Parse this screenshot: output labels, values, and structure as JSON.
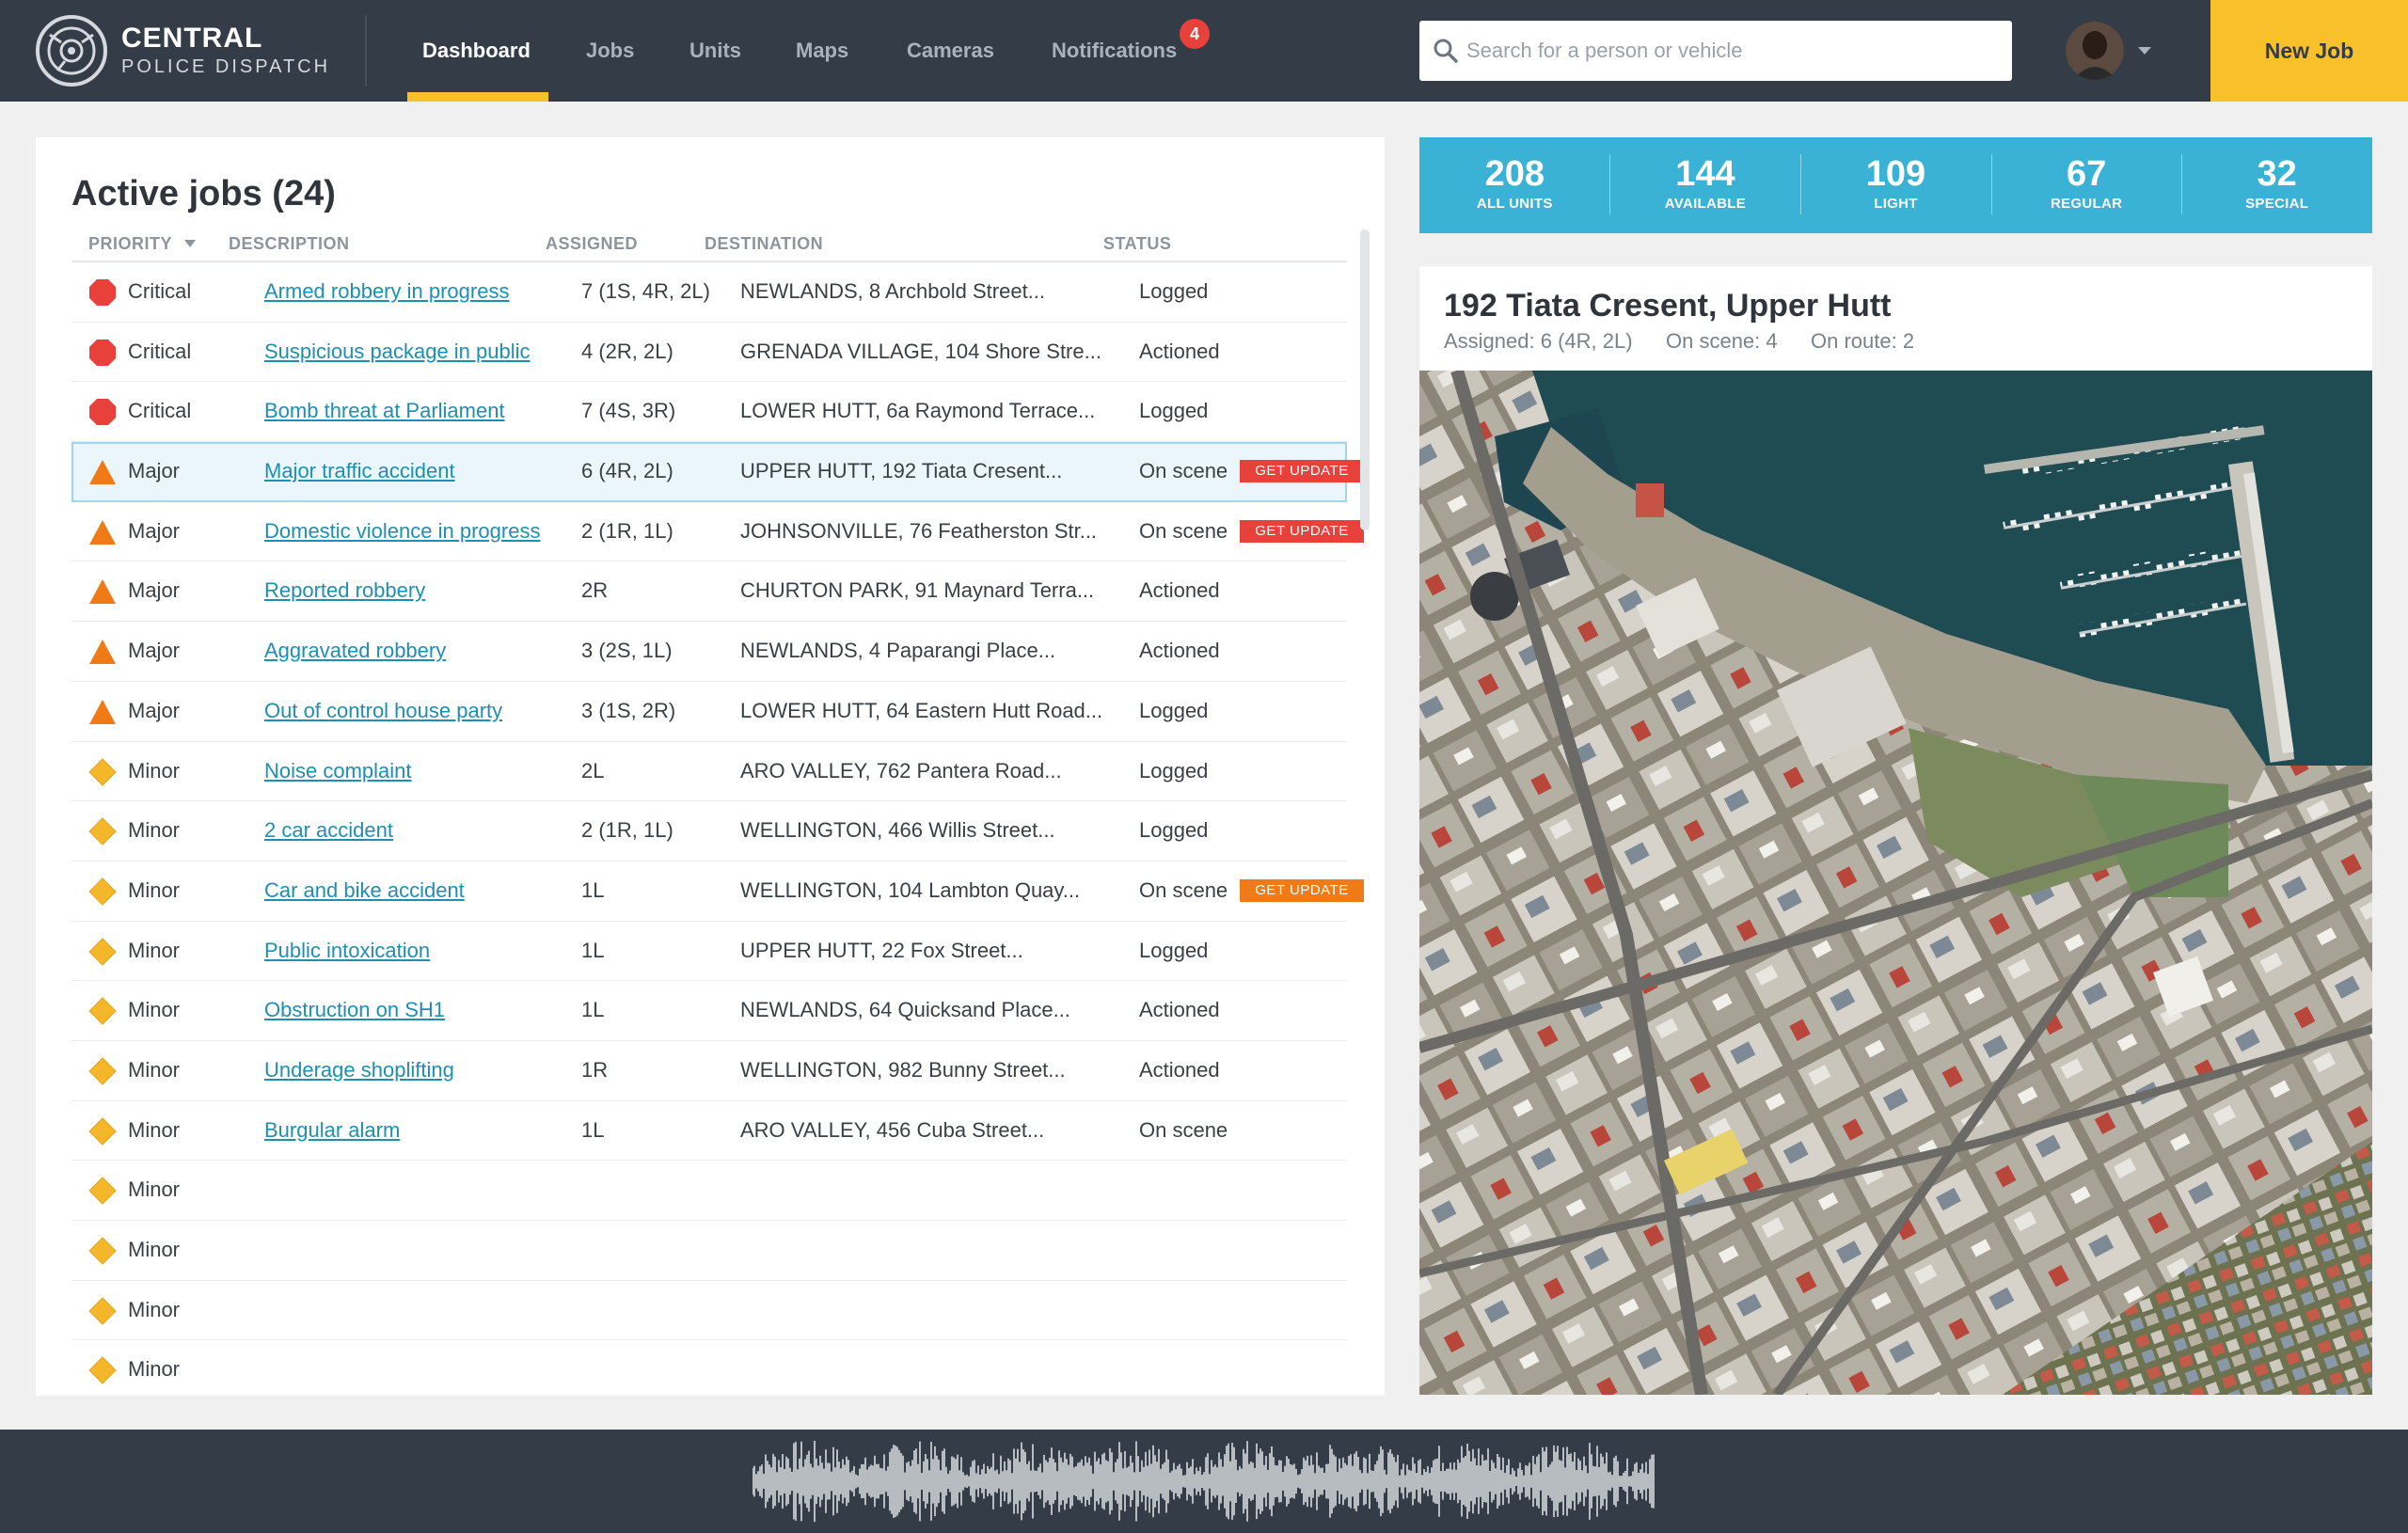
{
  "brand": {
    "line1": "CENTRAL",
    "line2": "POLICE DISPATCH"
  },
  "nav": {
    "items": [
      {
        "label": "Dashboard",
        "active": true
      },
      {
        "label": "Jobs"
      },
      {
        "label": "Units"
      },
      {
        "label": "Maps"
      },
      {
        "label": "Cameras"
      },
      {
        "label": "Notifications"
      }
    ],
    "notifications_count": "4"
  },
  "search": {
    "placeholder": "Search for a person or vehicle",
    "value": ""
  },
  "new_job_label": "New Job",
  "active_jobs": {
    "title": "Active jobs (24)",
    "columns": [
      "PRIORITY",
      "DESCRIPTION",
      "ASSIGNED",
      "DESTINATION",
      "STATUS"
    ],
    "sort_column": "PRIORITY",
    "get_update_label": "GET UPDATE",
    "rows": [
      {
        "priority": "Critical",
        "description": "Armed robbery in progress",
        "assigned": "7 (1S, 4R, 2L)",
        "destination": "NEWLANDS, 8 Archbold Street...",
        "status": "Logged"
      },
      {
        "priority": "Critical",
        "description": "Suspicious package in public",
        "assigned": "4 (2R, 2L)",
        "destination": "GRENADA VILLAGE, 104 Shore Stre...",
        "status": "Actioned"
      },
      {
        "priority": "Critical",
        "description": "Bomb threat at Parliament",
        "assigned": "7 (4S, 3R)",
        "destination": "LOWER HUTT, 6a Raymond Terrace...",
        "status": "Logged"
      },
      {
        "priority": "Major",
        "description": "Major traffic accident",
        "assigned": "6 (4R, 2L)",
        "destination": "UPPER HUTT, 192 Tiata Cresent...",
        "status": "On scene",
        "get_update": true,
        "get_update_color": "#e8413b",
        "selected": true
      },
      {
        "priority": "Major",
        "description": "Domestic violence in progress",
        "assigned": "2 (1R, 1L)",
        "destination": "JOHNSONVILLE, 76 Featherston Str...",
        "status": "On scene",
        "get_update": true,
        "get_update_color": "#e8413b"
      },
      {
        "priority": "Major",
        "description": "Reported robbery",
        "assigned": "2R",
        "destination": "CHURTON PARK, 91 Maynard Terra...",
        "status": "Actioned"
      },
      {
        "priority": "Major",
        "description": "Aggravated robbery",
        "assigned": "3 (2S, 1L)",
        "destination": "NEWLANDS, 4 Paparangi Place...",
        "status": "Actioned"
      },
      {
        "priority": "Major",
        "description": "Out of control house party",
        "assigned": "3 (1S, 2R)",
        "destination": "LOWER HUTT, 64 Eastern Hutt Road...",
        "status": "Logged"
      },
      {
        "priority": "Minor",
        "description": "Noise complaint",
        "assigned": "2L",
        "destination": "ARO VALLEY, 762 Pantera Road...",
        "status": "Logged"
      },
      {
        "priority": "Minor",
        "description": "2 car accident",
        "assigned": "2 (1R, 1L)",
        "destination": "WELLINGTON, 466 Willis Street...",
        "status": "Logged"
      },
      {
        "priority": "Minor",
        "description": "Car and bike accident",
        "assigned": "1L",
        "destination": "WELLINGTON, 104 Lambton Quay...",
        "status": "On scene",
        "get_update": true,
        "get_update_color": "#f07b16"
      },
      {
        "priority": "Minor",
        "description": "Public intoxication",
        "assigned": "1L",
        "destination": "UPPER HUTT, 22 Fox Street...",
        "status": "Logged"
      },
      {
        "priority": "Minor",
        "description": "Obstruction on SH1",
        "assigned": "1L",
        "destination": "NEWLANDS, 64 Quicksand Place...",
        "status": "Actioned"
      },
      {
        "priority": "Minor",
        "description": "Underage shoplifting",
        "assigned": "1R",
        "destination": "WELLINGTON, 982 Bunny Street...",
        "status": "Actioned"
      },
      {
        "priority": "Minor",
        "description": "Burgular alarm",
        "assigned": "1L",
        "destination": "ARO VALLEY, 456 Cuba Street...",
        "status": "On scene"
      },
      {
        "priority": "Minor",
        "description": "",
        "assigned": "",
        "destination": "",
        "status": ""
      },
      {
        "priority": "Minor",
        "description": "",
        "assigned": "",
        "destination": "",
        "status": ""
      },
      {
        "priority": "Minor",
        "description": "",
        "assigned": "",
        "destination": "",
        "status": ""
      },
      {
        "priority": "Minor",
        "description": "",
        "assigned": "",
        "destination": "",
        "status": ""
      }
    ]
  },
  "stats": [
    {
      "value": "208",
      "label": "ALL UNITS"
    },
    {
      "value": "144",
      "label": "AVAILABLE"
    },
    {
      "value": "109",
      "label": "LIGHT"
    },
    {
      "value": "67",
      "label": "REGULAR"
    },
    {
      "value": "32",
      "label": "SPECIAL"
    }
  ],
  "job_detail": {
    "title": "192 Tiata Cresent, Upper Hutt",
    "assigned": "Assigned: 6 (4R, 2L)",
    "on_scene": "On scene: 4",
    "on_route": "On route: 2"
  },
  "colors": {
    "critical": "#e8413b",
    "major": "#f07b16",
    "minor": "#f5b72a",
    "accent": "#f8c12c",
    "stats_bg": "#3ab2d6",
    "link": "#1d8fb3"
  },
  "icons": {
    "logo": "target-logo-icon",
    "search": "search-icon",
    "avatar_caret": "caret-down-icon",
    "sort": "sort-desc-icon",
    "critical": "octagon-icon",
    "major": "triangle-icon",
    "minor": "diamond-icon"
  }
}
